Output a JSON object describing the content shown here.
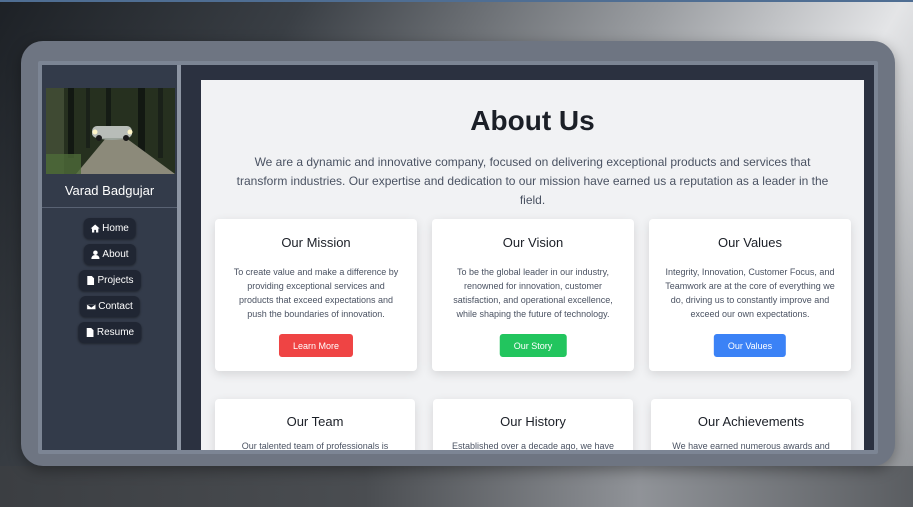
{
  "sidebar": {
    "name": "Varad Badgujar",
    "nav": [
      {
        "label": "Home",
        "icon": "home-icon"
      },
      {
        "label": "About",
        "icon": "user-icon"
      },
      {
        "label": "Projects",
        "icon": "file-icon"
      },
      {
        "label": "Contact",
        "icon": "envelope-icon"
      },
      {
        "label": "Resume",
        "icon": "file-icon"
      }
    ]
  },
  "main": {
    "title": "About Us",
    "intro": "We are a dynamic and innovative company, focused on delivering exceptional products and services that transform industries. Our expertise and dedication to our mission have earned us a reputation as a leader in the field.",
    "cards": [
      {
        "title": "Our Mission",
        "text": "To create value and make a difference by providing exceptional services and products that exceed expectations and push the boundaries of innovation.",
        "button": "Learn More",
        "button_color": "#ef4444"
      },
      {
        "title": "Our Vision",
        "text": "To be the global leader in our industry, renowned for innovation, customer satisfaction, and operational excellence, while shaping the future of technology.",
        "button": "Our Story",
        "button_color": "#22c55e"
      },
      {
        "title": "Our Values",
        "text": "Integrity, Innovation, Customer Focus, and Teamwork are at the core of everything we do, driving us to constantly improve and exceed our own expectations.",
        "button": "Our Values",
        "button_color": "#3b82f6"
      },
      {
        "title": "Our Team",
        "text": "Our talented team of professionals is"
      },
      {
        "title": "Our History",
        "text": "Established over a decade ago, we have"
      },
      {
        "title": "Our Achievements",
        "text": "We have earned numerous awards and"
      }
    ]
  }
}
